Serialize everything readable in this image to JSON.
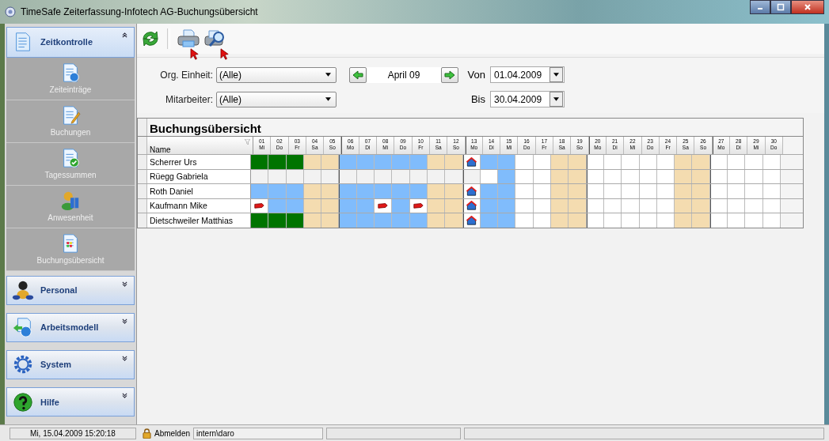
{
  "window": {
    "title": "TimeSafe Zeiterfassung-Infotech AG-Buchungsübersicht"
  },
  "sidebar": {
    "groups": [
      {
        "label": "Zeitkontrolle",
        "expanded": true,
        "items": [
          {
            "label": "Zeiteinträge"
          },
          {
            "label": "Buchungen"
          },
          {
            "label": "Tagessummen"
          },
          {
            "label": "Anwesenheit"
          },
          {
            "label": "Buchungsübersicht"
          }
        ]
      },
      {
        "label": "Personal",
        "expanded": false
      },
      {
        "label": "Arbeitsmodell",
        "expanded": false
      },
      {
        "label": "System",
        "expanded": false
      },
      {
        "label": "Hilfe",
        "expanded": false
      }
    ]
  },
  "filters": {
    "org_label": "Org. Einheit:",
    "org_value": "(Alle)",
    "employee_label": "Mitarbeiter:",
    "employee_value": "(Alle)",
    "period": "April 09",
    "from_label": "Von",
    "from_value": "01.04.2009",
    "to_label": "Bis",
    "to_value": "30.04.2009"
  },
  "grid": {
    "title": "Buchungsübersicht",
    "name_header": "Name",
    "days": [
      {
        "day": "01",
        "weekday": "Mi"
      },
      {
        "day": "02",
        "weekday": "Do"
      },
      {
        "day": "03",
        "weekday": "Fr"
      },
      {
        "day": "04",
        "weekday": "Sa"
      },
      {
        "day": "05",
        "weekday": "So"
      },
      {
        "day": "06",
        "weekday": "Mo"
      },
      {
        "day": "07",
        "weekday": "Di"
      },
      {
        "day": "08",
        "weekday": "Mi"
      },
      {
        "day": "09",
        "weekday": "Do"
      },
      {
        "day": "10",
        "weekday": "Fr"
      },
      {
        "day": "11",
        "weekday": "Sa"
      },
      {
        "day": "12",
        "weekday": "So"
      },
      {
        "day": "13",
        "weekday": "Mo"
      },
      {
        "day": "14",
        "weekday": "Di"
      },
      {
        "day": "15",
        "weekday": "Mi"
      },
      {
        "day": "16",
        "weekday": "Do"
      },
      {
        "day": "17",
        "weekday": "Fr"
      },
      {
        "day": "18",
        "weekday": "Sa"
      },
      {
        "day": "19",
        "weekday": "So"
      },
      {
        "day": "20",
        "weekday": "Mo"
      },
      {
        "day": "21",
        "weekday": "Di"
      },
      {
        "day": "22",
        "weekday": "Mi"
      },
      {
        "day": "23",
        "weekday": "Do"
      },
      {
        "day": "24",
        "weekday": "Fr"
      },
      {
        "day": "25",
        "weekday": "Sa"
      },
      {
        "day": "26",
        "weekday": "So"
      },
      {
        "day": "27",
        "weekday": "Mo"
      },
      {
        "day": "28",
        "weekday": "Di"
      },
      {
        "day": "29",
        "weekday": "Mi"
      },
      {
        "day": "30",
        "weekday": "Do"
      }
    ],
    "rows": [
      {
        "name": "Scherrer Urs",
        "cells": [
          {
            "kind": "present"
          },
          {
            "kind": "present"
          },
          {
            "kind": "present"
          },
          {
            "kind": "weekend"
          },
          {
            "kind": "weekend"
          },
          {
            "kind": "work"
          },
          {
            "kind": "work"
          },
          {
            "kind": "work"
          },
          {
            "kind": "work"
          },
          {
            "kind": "work"
          },
          {
            "kind": "weekend"
          },
          {
            "kind": "weekend"
          },
          {
            "kind": "holiday"
          },
          {
            "kind": "work"
          },
          {
            "kind": "work"
          },
          {
            "kind": "empty"
          },
          {
            "kind": "empty"
          },
          {
            "kind": "weekend"
          },
          {
            "kind": "weekend"
          },
          {
            "kind": "empty"
          },
          {
            "kind": "empty"
          },
          {
            "kind": "empty"
          },
          {
            "kind": "empty"
          },
          {
            "kind": "empty"
          },
          {
            "kind": "weekend"
          },
          {
            "kind": "weekend"
          },
          {
            "kind": "empty"
          },
          {
            "kind": "empty"
          },
          {
            "kind": "empty"
          },
          {
            "kind": "empty"
          }
        ]
      },
      {
        "name": "Rüegg Gabriela",
        "cells": [
          {
            "kind": "none"
          },
          {
            "kind": "none"
          },
          {
            "kind": "none"
          },
          {
            "kind": "none"
          },
          {
            "kind": "none"
          },
          {
            "kind": "none"
          },
          {
            "kind": "none"
          },
          {
            "kind": "none"
          },
          {
            "kind": "none"
          },
          {
            "kind": "none"
          },
          {
            "kind": "none"
          },
          {
            "kind": "none"
          },
          {
            "kind": "none"
          },
          {
            "kind": "empty"
          },
          {
            "kind": "work"
          },
          {
            "kind": "empty"
          },
          {
            "kind": "empty"
          },
          {
            "kind": "weekend"
          },
          {
            "kind": "weekend"
          },
          {
            "kind": "empty"
          },
          {
            "kind": "empty"
          },
          {
            "kind": "empty"
          },
          {
            "kind": "empty"
          },
          {
            "kind": "empty"
          },
          {
            "kind": "weekend"
          },
          {
            "kind": "weekend"
          },
          {
            "kind": "empty"
          },
          {
            "kind": "empty"
          },
          {
            "kind": "empty"
          },
          {
            "kind": "empty"
          }
        ]
      },
      {
        "name": "Roth Daniel",
        "cells": [
          {
            "kind": "work"
          },
          {
            "kind": "work"
          },
          {
            "kind": "work"
          },
          {
            "kind": "weekend"
          },
          {
            "kind": "weekend"
          },
          {
            "kind": "work"
          },
          {
            "kind": "work"
          },
          {
            "kind": "work"
          },
          {
            "kind": "work"
          },
          {
            "kind": "work"
          },
          {
            "kind": "weekend"
          },
          {
            "kind": "weekend"
          },
          {
            "kind": "holiday"
          },
          {
            "kind": "work"
          },
          {
            "kind": "work"
          },
          {
            "kind": "empty"
          },
          {
            "kind": "empty"
          },
          {
            "kind": "weekend"
          },
          {
            "kind": "weekend"
          },
          {
            "kind": "empty"
          },
          {
            "kind": "empty"
          },
          {
            "kind": "empty"
          },
          {
            "kind": "empty"
          },
          {
            "kind": "empty"
          },
          {
            "kind": "weekend"
          },
          {
            "kind": "weekend"
          },
          {
            "kind": "empty"
          },
          {
            "kind": "empty"
          },
          {
            "kind": "empty"
          },
          {
            "kind": "empty"
          }
        ]
      },
      {
        "name": "Kaufmann Mike",
        "cells": [
          {
            "kind": "absent"
          },
          {
            "kind": "work"
          },
          {
            "kind": "work"
          },
          {
            "kind": "weekend"
          },
          {
            "kind": "weekend"
          },
          {
            "kind": "work"
          },
          {
            "kind": "work"
          },
          {
            "kind": "absent"
          },
          {
            "kind": "work"
          },
          {
            "kind": "absent"
          },
          {
            "kind": "weekend"
          },
          {
            "kind": "weekend"
          },
          {
            "kind": "holiday"
          },
          {
            "kind": "work"
          },
          {
            "kind": "work"
          },
          {
            "kind": "empty"
          },
          {
            "kind": "empty"
          },
          {
            "kind": "weekend"
          },
          {
            "kind": "weekend"
          },
          {
            "kind": "empty"
          },
          {
            "kind": "empty"
          },
          {
            "kind": "empty"
          },
          {
            "kind": "empty"
          },
          {
            "kind": "empty"
          },
          {
            "kind": "weekend"
          },
          {
            "kind": "weekend"
          },
          {
            "kind": "empty"
          },
          {
            "kind": "empty"
          },
          {
            "kind": "empty"
          },
          {
            "kind": "empty"
          }
        ]
      },
      {
        "name": "Dietschweiler Matthias",
        "cells": [
          {
            "kind": "present"
          },
          {
            "kind": "present"
          },
          {
            "kind": "present"
          },
          {
            "kind": "weekend"
          },
          {
            "kind": "weekend"
          },
          {
            "kind": "work"
          },
          {
            "kind": "work"
          },
          {
            "kind": "work"
          },
          {
            "kind": "work"
          },
          {
            "kind": "work"
          },
          {
            "kind": "weekend"
          },
          {
            "kind": "weekend"
          },
          {
            "kind": "holiday"
          },
          {
            "kind": "work"
          },
          {
            "kind": "work"
          },
          {
            "kind": "empty"
          },
          {
            "kind": "empty"
          },
          {
            "kind": "weekend"
          },
          {
            "kind": "weekend"
          },
          {
            "kind": "empty"
          },
          {
            "kind": "empty"
          },
          {
            "kind": "empty"
          },
          {
            "kind": "empty"
          },
          {
            "kind": "empty"
          },
          {
            "kind": "weekend"
          },
          {
            "kind": "weekend"
          },
          {
            "kind": "empty"
          },
          {
            "kind": "empty"
          },
          {
            "kind": "empty"
          },
          {
            "kind": "empty"
          }
        ]
      }
    ]
  },
  "status_bar": {
    "datetime": "Mi, 15.04.2009 15:20:18",
    "logout": "Abmelden",
    "user": "intern\\daro"
  }
}
